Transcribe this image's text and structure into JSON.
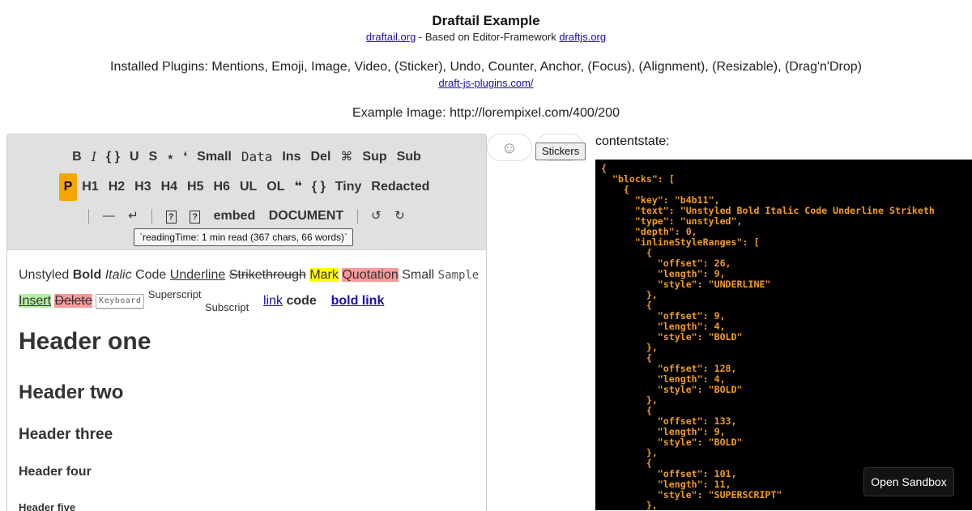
{
  "header": {
    "title": "Draftail Example",
    "link1": "draftail.org",
    "subtitle_mid": " - Based on Editor-Framework ",
    "link2": "draftjs.org",
    "plugins_text": "Installed Plugins: Mentions, Emoji, Image, Video, (Sticker), Undo, Counter, Anchor, (Focus), (Alignment), (Resizable), (Drag'n'Drop)",
    "plugins_link": "draft-js-plugins.com/",
    "example_image": "Example Image: http://lorempixel.com/400/200"
  },
  "toolbar": {
    "row1": [
      {
        "label": "B",
        "style": "bold"
      },
      {
        "label": "I",
        "style": "italic"
      },
      {
        "label": "{ }",
        "style": "bold"
      },
      {
        "label": "U",
        "style": "bold"
      },
      {
        "label": "S",
        "style": "bold"
      },
      {
        "label": "⭑",
        "style": "sym"
      },
      {
        "label": "❛",
        "style": "sym"
      },
      {
        "label": "Small",
        "style": "bold"
      },
      {
        "label": "Data",
        "style": "mono"
      },
      {
        "label": "Ins",
        "style": "bold"
      },
      {
        "label": "Del",
        "style": "bold"
      },
      {
        "label": "⌘",
        "style": "sym"
      },
      {
        "label": "Sup",
        "style": "bold"
      },
      {
        "label": "Sub",
        "style": "bold"
      }
    ],
    "row2": [
      {
        "label": "P",
        "active": true
      },
      {
        "label": "H1"
      },
      {
        "label": "H2"
      },
      {
        "label": "H3"
      },
      {
        "label": "H4"
      },
      {
        "label": "H5"
      },
      {
        "label": "H6"
      },
      {
        "label": "UL"
      },
      {
        "label": "OL"
      },
      {
        "label": "❝"
      },
      {
        "label": "{ }"
      },
      {
        "label": "Tiny"
      },
      {
        "label": "Redacted"
      }
    ],
    "row3": {
      "hr": "—",
      "br": "↵",
      "q1": "?",
      "q2": "?",
      "embed": "embed",
      "document": "DOCUMENT",
      "undo": "↺",
      "redo": "↻"
    },
    "reading_time": "`readingTime: 1 min read (367 chars, 66 words)`"
  },
  "content": {
    "line1": {
      "unstyled": "Unstyled ",
      "bold": "Bold",
      "italic": "Italic",
      "code": "Code",
      "underline": "Underline",
      "strike": "Strikethrough",
      "mark": "Mark",
      "quotation": "Quotation",
      "small": "Small",
      "sample": "Sample"
    },
    "line2": {
      "insert": "Insert",
      "delete": "Delete",
      "keyboard": "Keyboard",
      "superscript": "Superscript",
      "subscript": "Subscript",
      "link": "link",
      "code": "code",
      "bold_link": "bold link"
    },
    "h1": "Header one",
    "h2": "Header two",
    "h3": "Header three",
    "h4": "Header four",
    "h5": "Header five"
  },
  "side": {
    "emoji_icon": "☺",
    "stickers": "Stickers",
    "contentstate_label": "contentstate:",
    "open_sandbox": "Open Sandbox"
  },
  "json_lines": [
    "{",
    "  \"blocks\": [",
    "    {",
    "      \"key\": \"b4b11\",",
    "      \"text\": \"Unstyled Bold Italic Code Underline Striketh",
    "      \"type\": \"unstyled\",",
    "      \"depth\": 0,",
    "      \"inlineStyleRanges\": [",
    "        {",
    "          \"offset\": 26,",
    "          \"length\": 9,",
    "          \"style\": \"UNDERLINE\"",
    "        },",
    "        {",
    "          \"offset\": 9,",
    "          \"length\": 4,",
    "          \"style\": \"BOLD\"",
    "        },",
    "        {",
    "          \"offset\": 128,",
    "          \"length\": 4,",
    "          \"style\": \"BOLD\"",
    "        },",
    "        {",
    "          \"offset\": 133,",
    "          \"length\": 9,",
    "          \"style\": \"BOLD\"",
    "        },",
    "        {",
    "          \"offset\": 101,",
    "          \"length\": 11,",
    "          \"style\": \"SUPERSCRIPT\"",
    "        },"
  ]
}
